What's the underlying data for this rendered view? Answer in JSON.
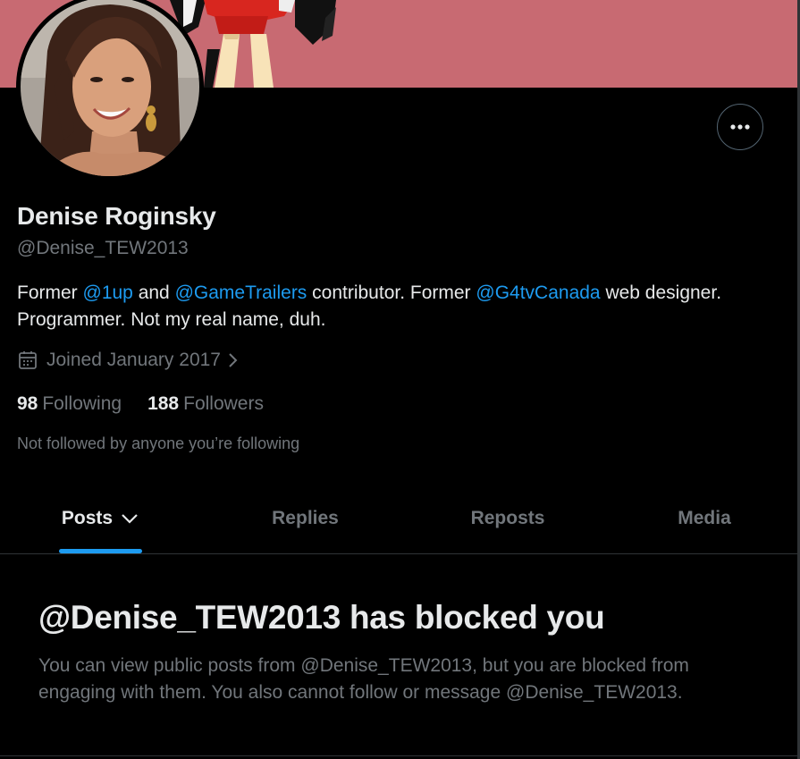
{
  "profile": {
    "display_name": "Denise Roginsky",
    "handle": "@Denise_TEW2013",
    "bio": {
      "part1": "Former ",
      "mention1": "@1up",
      "part2": " and ",
      "mention2": "@GameTrailers",
      "part3": " contributor. Former ",
      "mention3": "@G4tvCanada",
      "part4": " web designer. Programmer. Not my real name, duh."
    },
    "joined": "Joined January 2017",
    "following_count": "98",
    "following_label": "Following",
    "followers_count": "188",
    "followers_label": "Followers",
    "not_followed_text": "Not followed by anyone you’re following"
  },
  "tabs": [
    {
      "label": "Posts"
    },
    {
      "label": "Replies"
    },
    {
      "label": "Reposts"
    },
    {
      "label": "Media"
    }
  ],
  "blocked": {
    "title": "@Denise_TEW2013 has blocked you",
    "description": "You can view public posts from @Denise_TEW2013, but you are blocked from engaging with them. You also cannot follow or message @Denise_TEW2013."
  },
  "icons": {
    "more": "more-horizontal-icon",
    "calendar": "calendar-icon",
    "joined_chevron": "chevron-right-icon",
    "tab_chevron": "chevron-down-icon"
  },
  "colors": {
    "background": "#000000",
    "banner": "#c86a72",
    "accent": "#1d9bf0",
    "text_primary": "#e7e9ea",
    "text_secondary": "#71767b",
    "border": "#2f3336"
  }
}
